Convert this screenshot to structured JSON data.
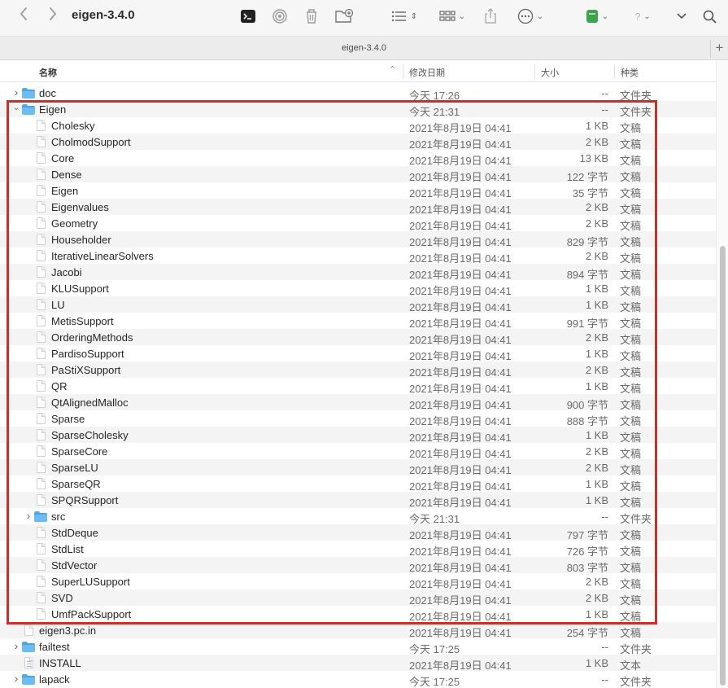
{
  "window": {
    "title": "eigen-3.4.0",
    "tab_label": "eigen-3.4.0"
  },
  "toolbar": {
    "back_icon": "chevron-left-icon",
    "forward_icon": "chevron-right-icon",
    "terminal_icon": "terminal-icon",
    "airdrop_icon": "airdrop-icon",
    "trash_icon": "trash-icon",
    "new_folder_icon": "new-folder-icon",
    "list_view_icon": "list-view-icon",
    "grid_view_icon": "grid-view-icon",
    "share_icon": "share-icon",
    "more_icon": "ellipsis-icon",
    "tag_icon": "green-tag-icon",
    "help_icon": "help-icon",
    "expand_icon": "chevron-down-icon",
    "search_icon": "search-icon",
    "tag_color": "#3fa34d"
  },
  "columns": {
    "name": "名称",
    "date": "修改日期",
    "size": "大小",
    "kind": "种类"
  },
  "rows": [
    {
      "depth": 0,
      "type": "folder",
      "expanded": false,
      "name": "doc",
      "date": "今天 17:26",
      "size": "--",
      "kind": "文件夹"
    },
    {
      "depth": 0,
      "type": "folder",
      "expanded": true,
      "name": "Eigen",
      "date": "今天 21:31",
      "size": "--",
      "kind": "文件夹"
    },
    {
      "depth": 1,
      "type": "doc",
      "name": "Cholesky",
      "date": "2021年8月19日 04:41",
      "size": "1 KB",
      "kind": "文稿"
    },
    {
      "depth": 1,
      "type": "doc",
      "name": "CholmodSupport",
      "date": "2021年8月19日 04:41",
      "size": "2 KB",
      "kind": "文稿"
    },
    {
      "depth": 1,
      "type": "doc",
      "name": "Core",
      "date": "2021年8月19日 04:41",
      "size": "13 KB",
      "kind": "文稿"
    },
    {
      "depth": 1,
      "type": "doc",
      "name": "Dense",
      "date": "2021年8月19日 04:41",
      "size": "122 字节",
      "kind": "文稿"
    },
    {
      "depth": 1,
      "type": "doc",
      "name": "Eigen",
      "date": "2021年8月19日 04:41",
      "size": "35 字节",
      "kind": "文稿"
    },
    {
      "depth": 1,
      "type": "doc",
      "name": "Eigenvalues",
      "date": "2021年8月19日 04:41",
      "size": "2 KB",
      "kind": "文稿"
    },
    {
      "depth": 1,
      "type": "doc",
      "name": "Geometry",
      "date": "2021年8月19日 04:41",
      "size": "2 KB",
      "kind": "文稿"
    },
    {
      "depth": 1,
      "type": "doc",
      "name": "Householder",
      "date": "2021年8月19日 04:41",
      "size": "829 字节",
      "kind": "文稿"
    },
    {
      "depth": 1,
      "type": "doc",
      "name": "IterativeLinearSolvers",
      "date": "2021年8月19日 04:41",
      "size": "2 KB",
      "kind": "文稿"
    },
    {
      "depth": 1,
      "type": "doc",
      "name": "Jacobi",
      "date": "2021年8月19日 04:41",
      "size": "894 字节",
      "kind": "文稿"
    },
    {
      "depth": 1,
      "type": "doc",
      "name": "KLUSupport",
      "date": "2021年8月19日 04:41",
      "size": "1 KB",
      "kind": "文稿"
    },
    {
      "depth": 1,
      "type": "doc",
      "name": "LU",
      "date": "2021年8月19日 04:41",
      "size": "1 KB",
      "kind": "文稿"
    },
    {
      "depth": 1,
      "type": "doc",
      "name": "MetisSupport",
      "date": "2021年8月19日 04:41",
      "size": "991 字节",
      "kind": "文稿"
    },
    {
      "depth": 1,
      "type": "doc",
      "name": "OrderingMethods",
      "date": "2021年8月19日 04:41",
      "size": "2 KB",
      "kind": "文稿"
    },
    {
      "depth": 1,
      "type": "doc",
      "name": "PardisoSupport",
      "date": "2021年8月19日 04:41",
      "size": "1 KB",
      "kind": "文稿"
    },
    {
      "depth": 1,
      "type": "doc",
      "name": "PaStiXSupport",
      "date": "2021年8月19日 04:41",
      "size": "2 KB",
      "kind": "文稿"
    },
    {
      "depth": 1,
      "type": "doc",
      "name": "QR",
      "date": "2021年8月19日 04:41",
      "size": "1 KB",
      "kind": "文稿"
    },
    {
      "depth": 1,
      "type": "doc",
      "name": "QtAlignedMalloc",
      "date": "2021年8月19日 04:41",
      "size": "900 字节",
      "kind": "文稿"
    },
    {
      "depth": 1,
      "type": "doc",
      "name": "Sparse",
      "date": "2021年8月19日 04:41",
      "size": "888 字节",
      "kind": "文稿"
    },
    {
      "depth": 1,
      "type": "doc",
      "name": "SparseCholesky",
      "date": "2021年8月19日 04:41",
      "size": "1 KB",
      "kind": "文稿"
    },
    {
      "depth": 1,
      "type": "doc",
      "name": "SparseCore",
      "date": "2021年8月19日 04:41",
      "size": "2 KB",
      "kind": "文稿"
    },
    {
      "depth": 1,
      "type": "doc",
      "name": "SparseLU",
      "date": "2021年8月19日 04:41",
      "size": "2 KB",
      "kind": "文稿"
    },
    {
      "depth": 1,
      "type": "doc",
      "name": "SparseQR",
      "date": "2021年8月19日 04:41",
      "size": "1 KB",
      "kind": "文稿"
    },
    {
      "depth": 1,
      "type": "doc",
      "name": "SPQRSupport",
      "date": "2021年8月19日 04:41",
      "size": "1 KB",
      "kind": "文稿"
    },
    {
      "depth": 1,
      "type": "folder",
      "expanded": false,
      "name": "src",
      "date": "今天 21:31",
      "size": "--",
      "kind": "文件夹"
    },
    {
      "depth": 1,
      "type": "doc",
      "name": "StdDeque",
      "date": "2021年8月19日 04:41",
      "size": "797 字节",
      "kind": "文稿"
    },
    {
      "depth": 1,
      "type": "doc",
      "name": "StdList",
      "date": "2021年8月19日 04:41",
      "size": "726 字节",
      "kind": "文稿"
    },
    {
      "depth": 1,
      "type": "doc",
      "name": "StdVector",
      "date": "2021年8月19日 04:41",
      "size": "803 字节",
      "kind": "文稿"
    },
    {
      "depth": 1,
      "type": "doc",
      "name": "SuperLUSupport",
      "date": "2021年8月19日 04:41",
      "size": "2 KB",
      "kind": "文稿"
    },
    {
      "depth": 1,
      "type": "doc",
      "name": "SVD",
      "date": "2021年8月19日 04:41",
      "size": "2 KB",
      "kind": "文稿"
    },
    {
      "depth": 1,
      "type": "doc",
      "name": "UmfPackSupport",
      "date": "2021年8月19日 04:41",
      "size": "1 KB",
      "kind": "文稿"
    },
    {
      "depth": 0,
      "type": "doc",
      "name": "eigen3.pc.in",
      "date": "2021年8月19日 04:41",
      "size": "254 字节",
      "kind": "文稿"
    },
    {
      "depth": 0,
      "type": "folder",
      "expanded": false,
      "name": "failtest",
      "date": "今天 17:25",
      "size": "--",
      "kind": "文件夹"
    },
    {
      "depth": 0,
      "type": "text",
      "name": "INSTALL",
      "date": "2021年8月19日 04:41",
      "size": "1 KB",
      "kind": "文本"
    },
    {
      "depth": 0,
      "type": "folder",
      "expanded": false,
      "name": "lapack",
      "date": "今天 17:25",
      "size": "--",
      "kind": "文件夹"
    }
  ],
  "annotation": {
    "highlight_color": "#c9302c",
    "highlighted_folder": "Eigen"
  }
}
